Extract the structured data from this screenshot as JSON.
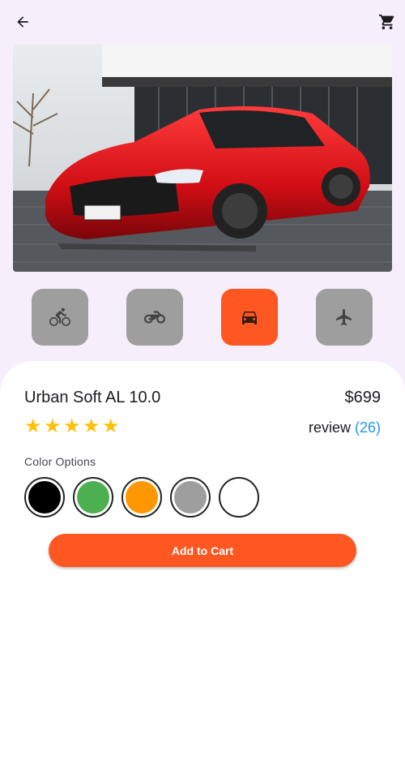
{
  "topbar": {
    "back_icon": "arrow-back-icon",
    "cart_icon": "shopping-cart-icon"
  },
  "hero": {
    "image": "red-sports-car-photo"
  },
  "categories": [
    {
      "icon": "bicycle-icon",
      "active": false
    },
    {
      "icon": "motorcycle-icon",
      "active": false
    },
    {
      "icon": "car-icon",
      "active": true
    },
    {
      "icon": "airplane-icon",
      "active": false
    }
  ],
  "product": {
    "title": "Urban Soft AL 10.0",
    "price": "$699",
    "rating": 5,
    "review_label": "review",
    "review_count": "(26)",
    "color_label": "Color Options",
    "colors": [
      "#000000",
      "#4caf50",
      "#ff9800",
      "#9e9e9e",
      "#ffffff"
    ],
    "add_to_cart": "Add to Cart"
  },
  "colors": {
    "accent": "#ff5722",
    "inactive": "#9e9e9e",
    "star": "#ffc107",
    "link": "#2196f3",
    "background": "#f6eefb"
  }
}
